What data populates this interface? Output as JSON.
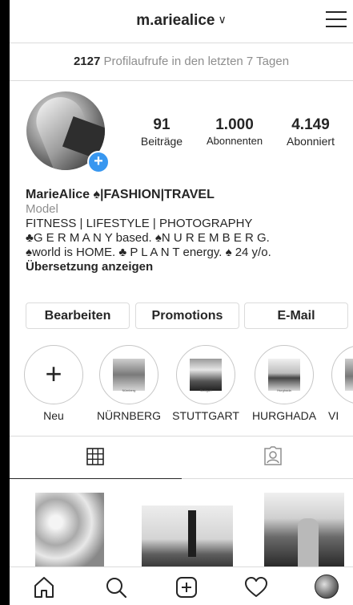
{
  "header": {
    "username": "m.ariealice",
    "chevron": "∨"
  },
  "profile_views": {
    "count": "2127",
    "text": "Profilaufrufe in den letzten 7 Tagen"
  },
  "stats": [
    {
      "value": "91",
      "label": "Beiträge"
    },
    {
      "value": "1.000",
      "label": "Abonnenten"
    },
    {
      "value": "4.149",
      "label": "Abonniert"
    }
  ],
  "bio": {
    "name": "MarieAlice ♠|FASHION|TRAVEL",
    "category": "Model",
    "line1": "FITNESS | LIFESTYLE | PHOTOGRAPHY",
    "line2": "♣G E R M A N Y based. ♠N U R E M B E R G.",
    "line3": "♠world is HOME. ♣ P L A N T energy. ♠ 24 y/o.",
    "translate": "Übersetzung anzeigen"
  },
  "buttons": {
    "edit": "Bearbeiten",
    "promotions": "Promotions",
    "email": "E-Mail"
  },
  "highlights": [
    {
      "label": "Neu",
      "caption": ""
    },
    {
      "label": "NÜRNBERG",
      "caption": "Nürnberg"
    },
    {
      "label": "STUTTGART",
      "caption": "Stuttgart"
    },
    {
      "label": "HURGHADA",
      "caption": "Hurghada"
    },
    {
      "label": "VI",
      "caption": ""
    }
  ],
  "tabs": [
    {
      "icon": "grid-icon",
      "active": true
    },
    {
      "icon": "tagged-icon",
      "active": false
    }
  ],
  "bottom_nav": [
    "home-icon",
    "search-icon",
    "add-post-icon",
    "activity-heart-icon",
    "profile-avatar"
  ],
  "colors": {
    "accent": "#3897f0",
    "border": "#dbdbdb",
    "muted": "#8e8e8e",
    "text": "#262626"
  }
}
